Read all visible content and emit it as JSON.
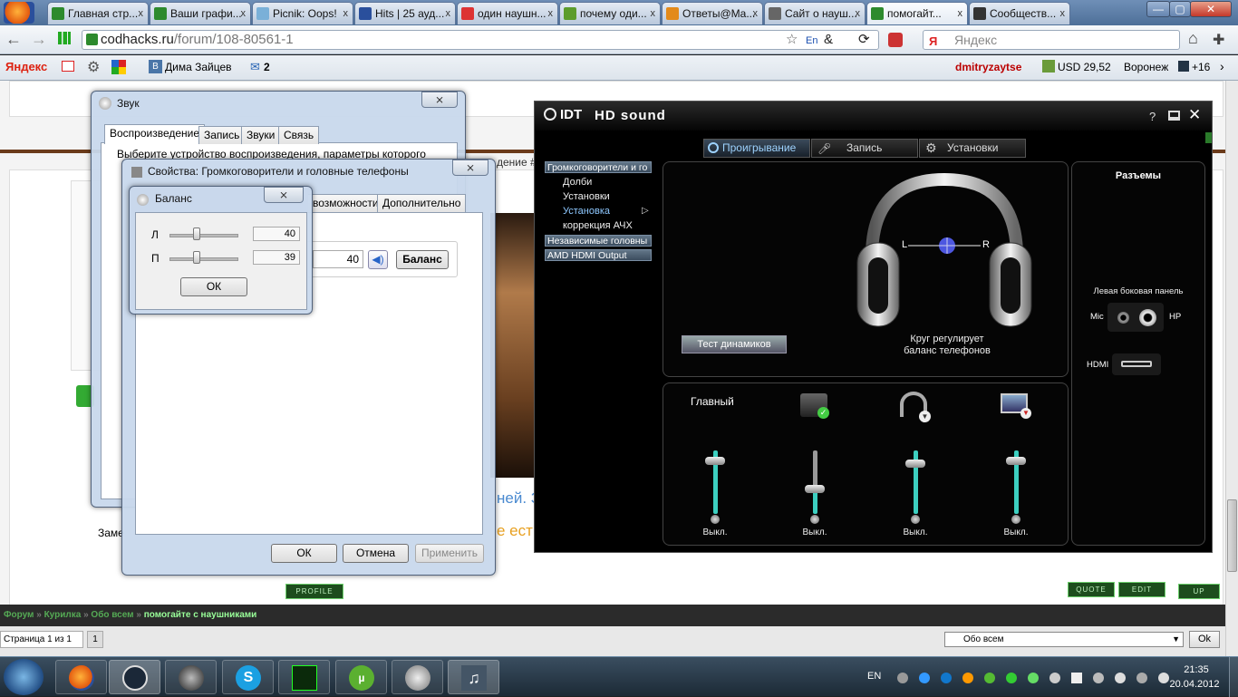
{
  "browser": {
    "tabs": [
      {
        "label": "Главная стр...",
        "icon_color": "#2d8a2d"
      },
      {
        "label": "Ваши графи...",
        "icon_color": "#2d8a2d"
      },
      {
        "label": "Picnik: Oops!",
        "icon_color": "#7ab0d8"
      },
      {
        "label": "Hits | 25 ауд...",
        "icon_color": "#2a4f9c"
      },
      {
        "label": "один наушн...",
        "icon_color": "#d33"
      },
      {
        "label": "почему оди...",
        "icon_color": "#5c9c2c"
      },
      {
        "label": "Ответы@Ma...",
        "icon_color": "#e38a1a"
      },
      {
        "label": "Сайт о науш...",
        "icon_color": "#666"
      },
      {
        "label": "помогайт...",
        "icon_color": "#2d8a2d",
        "active": true
      },
      {
        "label": "Сообществ...",
        "icon_color": "#333"
      }
    ],
    "tab_close": "x",
    "url_host": "codhacks.ru",
    "url_path": "/forum/108-80561-1",
    "search_placeholder": "Яндекс",
    "window_buttons": [
      "—",
      "▢",
      "✕"
    ]
  },
  "yandex_bar": {
    "logo": "Яндекс",
    "user": "Дима Зайцев",
    "mail_count": "2",
    "login": "dmitryzaytse",
    "currency": "USD 29,52",
    "city": "Воронеж",
    "temperature": "+16"
  },
  "forum": {
    "buttons": {
      "profile": "PROFILE",
      "quote": "QUOTE",
      "edit": "EDIT",
      "up": "UP"
    },
    "partial_text_1": "дение #",
    "partial_text_2": "ней. З",
    "partial_text_3": "е ест",
    "partial_text_4": "Заме",
    "breadcrumb": [
      "Форум",
      "Курилка",
      "Обо всем",
      "помогайте с наушниками"
    ],
    "pagination_label": "Страница 1 из 1",
    "pagination_page": "1",
    "jump_select": "Обо всем",
    "jump_ok": "Ok"
  },
  "sound_dialog": {
    "title": "Звук",
    "tabs": [
      "Воспроизведение",
      "Запись",
      "Звуки",
      "Связь"
    ],
    "description": "Выберите устройство воспроизведения, параметры которого"
  },
  "props_dialog": {
    "title": "Свойства: Громкоговорители и головные телефоны",
    "tabs": [
      "возможности",
      "Дополнительно"
    ],
    "level_value": "40",
    "balance_button": "Баланс",
    "ok": "ОК",
    "cancel": "Отмена",
    "apply": "Применить"
  },
  "balance_dialog": {
    "title": "Баланс",
    "left_label": "Л",
    "left_value": "40",
    "right_label": "П",
    "right_value": "39",
    "left_level": 40,
    "right_level": 39,
    "ok": "ОК"
  },
  "idt": {
    "logo": "IDT",
    "title": "HD sound",
    "help": "?",
    "tabs": [
      "Проигрывание",
      "Запись",
      "Установки"
    ],
    "tree": [
      {
        "label": "Громкоговорители и го",
        "selected": true
      },
      {
        "label": "Независимые головны"
      },
      {
        "label": "AMD HDMI Output"
      }
    ],
    "subitems": [
      "Долби",
      "Установки",
      "Установка",
      "коррекция АЧХ"
    ],
    "headphone_left": "L",
    "headphone_right": "R",
    "test_button": "Тест динамиков",
    "caption_line1": "Круг регулирует",
    "caption_line2": "баланс телефонов",
    "connectors_title": "Разъемы",
    "panel_label": "Левая боковая панель",
    "mic": "Mic",
    "hp": "HP",
    "hdmi": "HDMI",
    "master": "Главный",
    "off_label": "Выкл.",
    "levels": [
      0.85,
      0.4,
      0.8,
      0.85
    ]
  },
  "taskbar": {
    "lang": "EN",
    "time": "21:35",
    "date": "20.04.2012"
  }
}
